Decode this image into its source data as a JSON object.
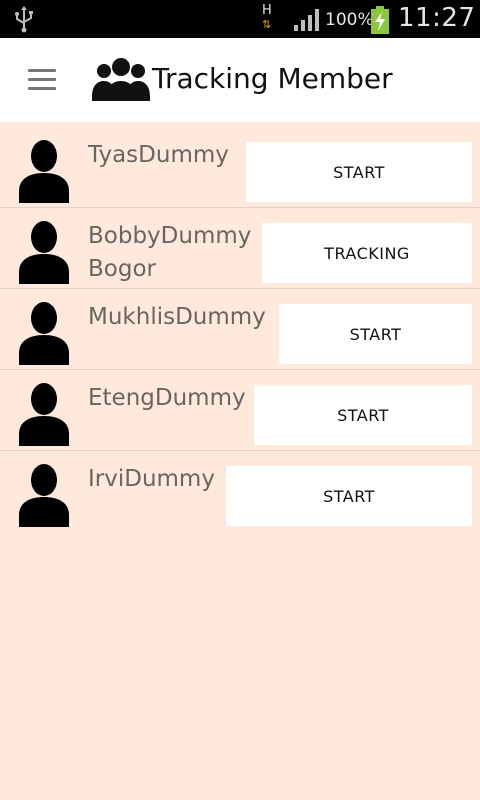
{
  "status_bar": {
    "network_type": "H",
    "battery_percent": "100%",
    "time": "11:27",
    "icons": [
      "usb-icon",
      "data-arrows-icon",
      "signal-icon",
      "battery-charging-icon"
    ],
    "battery_color": "#8cc63f"
  },
  "app_bar": {
    "title": "Tracking Member",
    "menu_icon": "hamburger-menu-icon",
    "title_icon": "group-icon"
  },
  "members": [
    {
      "name": "TyasDummy",
      "button": "START"
    },
    {
      "name": "BobbyDummy Bogor",
      "button": "TRACKING"
    },
    {
      "name": "MukhlisDummy",
      "button": "START"
    },
    {
      "name": "EtengDummy",
      "button": "START"
    },
    {
      "name": "IrviDummy",
      "button": "START"
    }
  ],
  "colors": {
    "background": "#FFE9DD",
    "app_bar": "#FFFFFF",
    "status_bar": "#000000",
    "name_text": "#6b6560",
    "button_bg": "#FFFFFF"
  }
}
